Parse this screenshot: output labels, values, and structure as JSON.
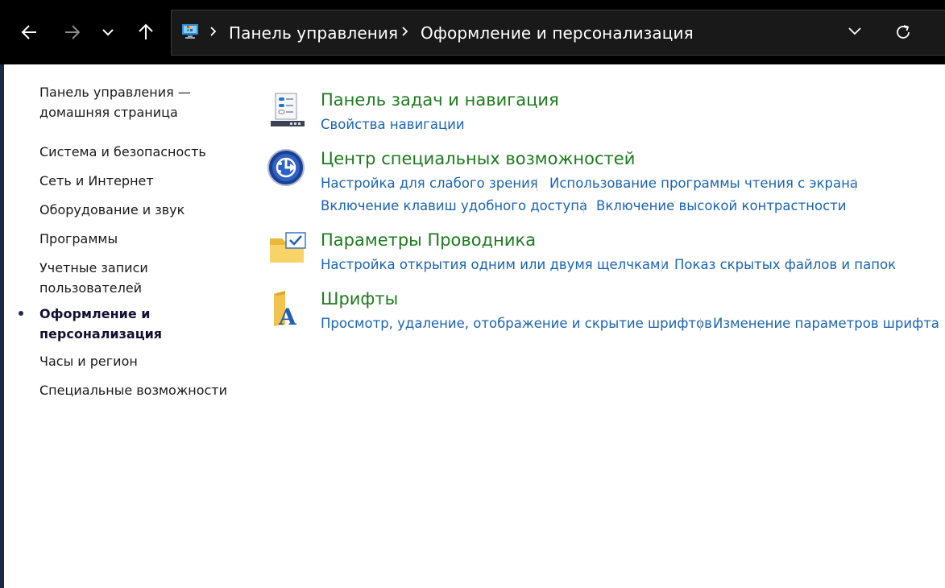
{
  "address_bar": {
    "crumbs": [
      "Панель управления",
      "Оформление и персонализация"
    ]
  },
  "icons": {
    "back": "arrow-left-icon",
    "forward": "arrow-right-icon",
    "recent": "chevron-down-icon",
    "up": "arrow-up-icon",
    "control_panel": "control-panel-icon",
    "address_dropdown": "chevron-down-icon",
    "refresh": "refresh-icon"
  },
  "sidebar": {
    "home": "Панель управления —\nдомашняя страница",
    "items": [
      {
        "label": "Система и безопасность",
        "active": false
      },
      {
        "label": "Сеть и Интернет",
        "active": false
      },
      {
        "label": "Оборудование и звук",
        "active": false
      },
      {
        "label": "Программы",
        "active": false
      },
      {
        "label": "Учетные записи\nпользователей",
        "active": false
      },
      {
        "label": "Оформление и\nперсонализация",
        "active": true
      },
      {
        "label": "Часы и регион",
        "active": false
      },
      {
        "label": "Специальные возможности",
        "active": false
      }
    ]
  },
  "categories": [
    {
      "title": "Панель задач и навигация",
      "icon": "taskbar-icon",
      "links": [
        "Свойства навигации"
      ]
    },
    {
      "title": "Центр специальных возможностей",
      "icon": "ease-of-access-icon",
      "links": [
        "Настройка для слабого зрения",
        "Использование программы чтения с экрана",
        "Включение клавиш удобного доступа",
        "Включение высокой контрастности"
      ]
    },
    {
      "title": "Параметры Проводника",
      "icon": "folder-options-icon",
      "links": [
        "Настройка открытия одним или двумя щелчками",
        "Показ скрытых файлов и папок"
      ]
    },
    {
      "title": "Шрифты",
      "icon": "fonts-icon",
      "links": [
        "Просмотр, удаление, отображение и скрытие шрифтов",
        "Изменение параметров шрифта"
      ]
    }
  ],
  "colors": {
    "title_green": "#1c7b1c",
    "link_blue": "#1a64b4",
    "topbar": "#000000"
  }
}
